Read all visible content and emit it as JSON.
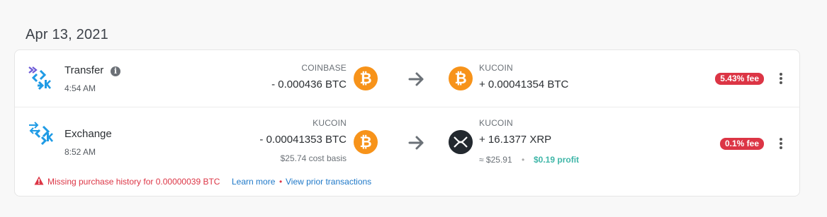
{
  "date_header": "Apr 13, 2021",
  "transactions": [
    {
      "type": "Transfer",
      "time": "4:54 AM",
      "from_wallet": "COINBASE",
      "from_amount": "- 0.000436 BTC",
      "from_icon": "bitcoin-icon",
      "to_wallet": "KUCOIN",
      "to_amount": "+ 0.00041354 BTC",
      "to_icon": "bitcoin-icon",
      "fee_badge": "5.43% fee"
    },
    {
      "type": "Exchange",
      "time": "8:52 AM",
      "from_wallet": "KUCOIN",
      "from_amount": "- 0.00041353 BTC",
      "from_cost_basis": "$25.74 cost basis",
      "from_icon": "bitcoin-icon",
      "to_wallet": "KUCOIN",
      "to_amount": "+ 16.1377 XRP",
      "to_value": "≈ $25.91",
      "to_profit": "$0.19 profit",
      "to_icon": "xrp-icon",
      "fee_badge": "0.1% fee",
      "warning": {
        "text": "Missing purchase history for 0.00000039 BTC",
        "learn_more": "Learn more",
        "separator": "•",
        "view_prior": "View prior transactions"
      }
    }
  ],
  "symbols": {
    "btc_glyph": "₿",
    "info_glyph": "i",
    "value_separator": "•"
  },
  "colors": {
    "btc": "#f7931a",
    "xrp": "#23292f",
    "fee_badge": "#dc3545",
    "profit": "#3fb6a8",
    "link": "#1e78c8",
    "warning": "#dc3545",
    "kucoin_blue": "#1f9be5",
    "transfer_purple": "#6d5ad7"
  }
}
